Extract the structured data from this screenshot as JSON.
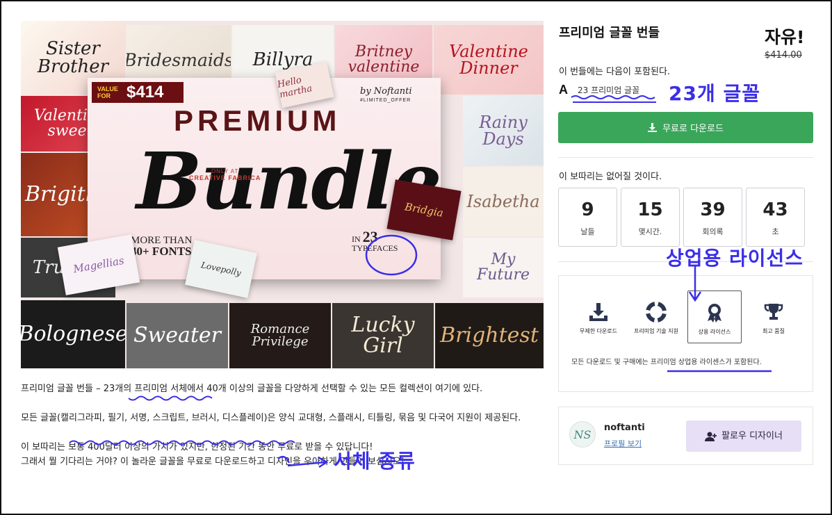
{
  "hero": {
    "tiles": {
      "top1": "Sister Brother",
      "top2": "Bridesmaids",
      "top3": "Billyra",
      "top4": "Britney valentine",
      "top5": "Valentine Dinner",
      "left1": "Valentine sweet",
      "left2": "Brigitha",
      "left3": "Trusted",
      "right1": "Rainy Days",
      "right2": "Isabetha",
      "right3": "My Future",
      "bot1": "Bolognese",
      "bot2": "Sweater",
      "bot3": "Romance Privilege",
      "bot4": "Lucky Girl",
      "bot5": "Brightest"
    },
    "value_for": "VALUE FOR",
    "value_amount": "$414",
    "by": "by Noftanti",
    "limited": "#LIMITED_OFFER",
    "premium": "PREMIUM",
    "only_at": "ONLY AT",
    "creative_fabrica": "CREATIVE FABRICA",
    "bundle": "Bundle",
    "more_than": "MORE THAN",
    "more_fonts": "40+ FONTS",
    "in_label": "IN",
    "in_number": "23",
    "typefaces": "TYPEFACES",
    "float1": "Hello martha",
    "float2": "Bridgia",
    "float3": "Magellias",
    "float4": "Lovepolly"
  },
  "description": {
    "p1": "프리미엄 글꼴 번들 – 23개의 프리미엄 서체에서 40개 이상의 글꼴을 다양하게 선택할 수 있는 모든 컬렉션이 여기에 있다.",
    "p2": "모든 글꼴(캘리그라피, 필기, 서명, 스크립트, 브러시, 디스플레이)은 양식 교대형, 스플래시, 티틀링, 묶음 및 다국어 지원이 제공된다.",
    "p3a": "이 보따리는 보통 400달러 이상의 가치가 있지만, 한정된 기간 동안 무료로 받을 수 있답니다!",
    "p3b": "그래서 뭘 기다리는 거야? 이 놀라운 글꼴을 무료로 다운로드하고 디자인을 우아하게 만들어 보십시오!"
  },
  "product": {
    "title": "프리미엄 글꼴 번들",
    "price": "자유!",
    "old_price": "$414.00",
    "includes": "이 번들에는 다음이 포함된다.",
    "font_icon": "A",
    "font_count": "23 프리미엄 글꼴",
    "download_label": "무료로 다운로드"
  },
  "countdown": {
    "heading": "이 보따리는 없어질 것이다.",
    "items": [
      {
        "value": "9",
        "label": "날들"
      },
      {
        "value": "15",
        "label": "몇시간."
      },
      {
        "value": "39",
        "label": "회의록"
      },
      {
        "value": "43",
        "label": "초"
      }
    ]
  },
  "features": [
    {
      "label": "무제한 다운로드",
      "icon": "download-tray-icon"
    },
    {
      "label": "프리미엄 기술 지원",
      "icon": "lifebuoy-icon"
    },
    {
      "label": "상용 라이선스",
      "icon": "award-ribbon-icon"
    },
    {
      "label": "최고 품질",
      "icon": "trophy-icon"
    }
  ],
  "license_note": "모든 다운로드 및 구매에는 프리미엄 상업용 라이센스가 포함된다.",
  "designer": {
    "initials": "NS",
    "name": "noftanti",
    "profile_link": "프로필 보기",
    "follow_label": "팔로우 디자이너"
  },
  "annotations": {
    "fonts_23": "23개 글꼴",
    "commercial_license": "상업용 라이선스",
    "typeface_kinds": "서체 종류"
  },
  "colors": {
    "download_green": "#3aa65a",
    "follow_lavender": "#e6dff5",
    "annotation_blue": "#3a2ee8"
  }
}
